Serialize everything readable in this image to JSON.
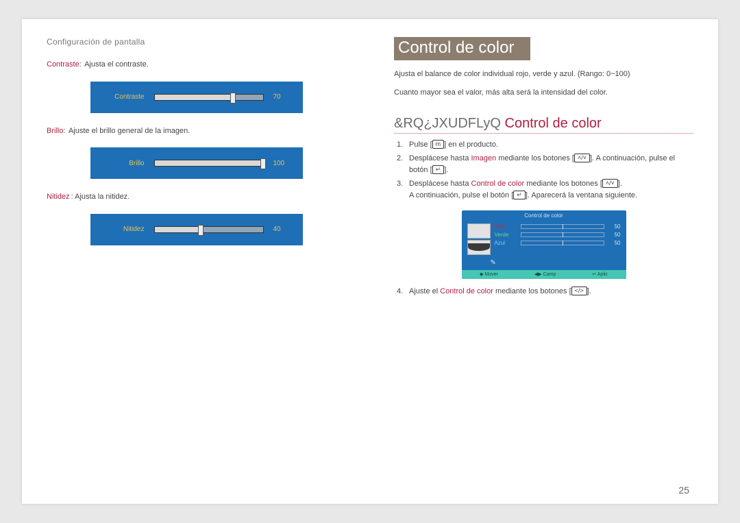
{
  "header": "Configuración de pantalla",
  "left": {
    "contrast": {
      "label": "Contraste:",
      "desc": "Ajusta el contraste."
    },
    "contrast_slider": {
      "label": "Contraste",
      "value": "70",
      "pct": 70
    },
    "brillo": {
      "label": "Brillo:",
      "desc": "Ajuste el brillo general de la imagen."
    },
    "brillo_slider": {
      "label": "Brillo",
      "value": "100",
      "pct": 100
    },
    "nitidez": {
      "label": "Nitidez",
      "suffix": ":",
      "desc": "Ajusta la nitidez."
    },
    "nitidez_slider": {
      "label": "Nitidez",
      "value": "40",
      "pct": 40
    }
  },
  "right": {
    "title": "Control de color",
    "intro1": "Ajusta el balance de color individual rojo, verde y azul. (Rango: 0~100)",
    "intro2": "Cuanto mayor sea el valor, más alta será la intensidad del color.",
    "subheading_prefix": "&RQ¿JXUDFLyQ ",
    "subheading_accent": "Control de color",
    "steps": {
      "s1_a": "Pulse [",
      "s1_icon": "m",
      "s1_b": "] en el producto.",
      "s2_a": "Desplácese hasta ",
      "s2_img": "Imagen",
      "s2_b": " mediante los botones [",
      "s2_icon1": "˄/˅",
      "s2_c": "]. A continuación, pulse el botón [",
      "s2_icon2": "↵",
      "s2_d": "].",
      "s3_a": "Desplácese hasta ",
      "s3_cc": "Control de color",
      "s3_b": " mediante los botones [",
      "s3_icon1": "˄/˅",
      "s3_c": "].",
      "s3_line2_a": "A continuación, pulse el botón [",
      "s3_line2_icon": "↵",
      "s3_line2_b": "]. Aparecerá la ventana siguiente.",
      "s4_a": "Ajuste el ",
      "s4_cc": "Control de color",
      "s4_b": " mediante los botones [",
      "s4_icon": "</>",
      "s4_c": "]."
    },
    "panel": {
      "title": "Control de color",
      "rows": [
        {
          "name": "Rojo",
          "cls": "r",
          "val": "50"
        },
        {
          "name": "Verde",
          "cls": "g",
          "val": "50"
        },
        {
          "name": "Azul",
          "cls": "b",
          "val": "50"
        }
      ],
      "footer": [
        "◆ Mover",
        "◀▶ Camp",
        "↵ Aplic"
      ]
    }
  },
  "page_number": "25"
}
